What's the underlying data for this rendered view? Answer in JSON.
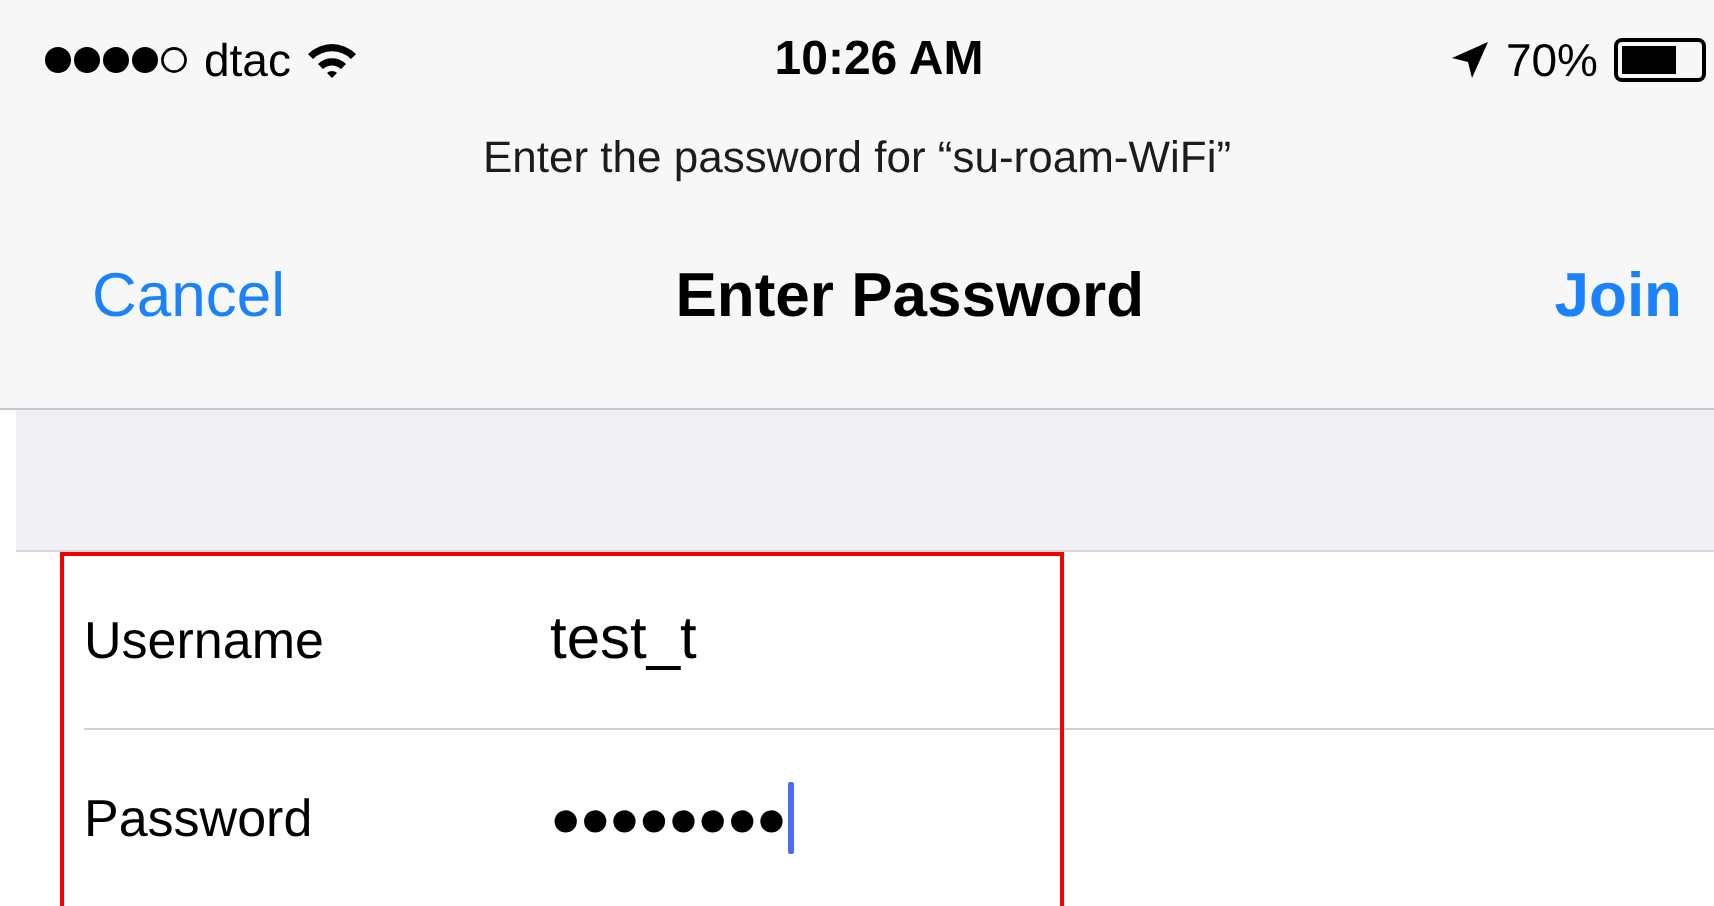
{
  "status_bar": {
    "carrier": "dtac",
    "time": "10:26 AM",
    "battery": "70%"
  },
  "prompt": "Enter the password for “su-roam-WiFi”",
  "nav_bar": {
    "cancel": "Cancel",
    "title": "Enter Password",
    "join": "Join"
  },
  "form": {
    "highlighted": true,
    "fields": [
      {
        "label": "Username",
        "value": "test_t",
        "focused": false
      },
      {
        "label": "Password",
        "value": "●●●●●●●●",
        "focused": true
      }
    ]
  }
}
